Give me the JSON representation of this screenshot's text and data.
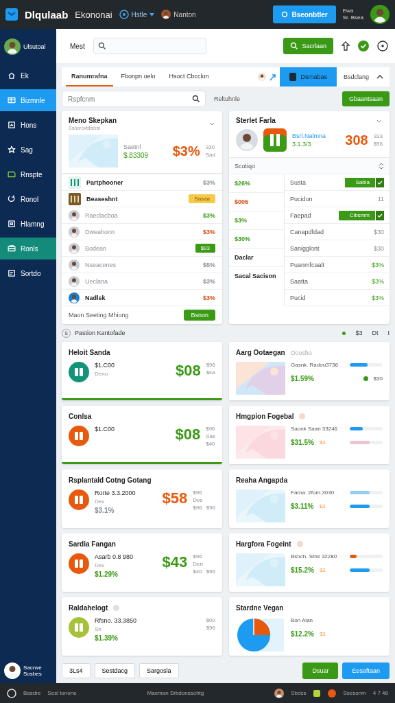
{
  "topbar": {
    "logo": "Dlqulaab",
    "app_name": "Ekononai",
    "nav": [
      {
        "label": "Hstle",
        "kind": "dropdown"
      },
      {
        "label": "Nanton",
        "kind": "user"
      }
    ],
    "action_button": "Bseonbtler",
    "status": [
      "Ewa",
      "Sr. Bsea"
    ]
  },
  "sidebar": {
    "user": "Ulsutoal",
    "items": [
      {
        "label": "Ek",
        "selected": false,
        "hovered": false
      },
      {
        "label": "Bizmnle",
        "selected": true,
        "hovered": false
      },
      {
        "label": "Hons",
        "selected": false,
        "hovered": false
      },
      {
        "label": "Sag",
        "selected": false,
        "hovered": false
      },
      {
        "label": "Rnspte",
        "selected": false,
        "hovered": false
      },
      {
        "label": "Ronol",
        "selected": false,
        "hovered": false
      },
      {
        "label": "Hlamng",
        "selected": false,
        "hovered": false
      },
      {
        "label": "Ronls",
        "selected": false,
        "hovered": true
      },
      {
        "label": "Sortdo",
        "selected": false,
        "hovered": false
      }
    ],
    "footer_user": [
      "Sacrwe",
      "Sosbes"
    ]
  },
  "header": {
    "title": "Mest",
    "button": "Sacrlaan"
  },
  "tabs": [
    {
      "label": "Ranumrafna",
      "selected": true
    },
    {
      "label": "Fbonpn oelo",
      "selected": false
    },
    {
      "label": "Hsoct Cbcclon",
      "selected": false
    }
  ],
  "tab_actions": {
    "primary": "Dsrnabas",
    "secondary": "Bsdclang"
  },
  "filter": {
    "placeholder": "Rspfcnm",
    "label": "Reltuhnle",
    "button": "Gbaantsaan"
  },
  "panels": {
    "left": {
      "title": "Meno Skepkan",
      "subtitle": "Ssnoroxtdstxte",
      "caption": "Saetnl",
      "amount": "$.83309",
      "big": "$3%",
      "side": [
        "330",
        "Sad"
      ],
      "rows": [
        {
          "label": "Partphooner",
          "bold": true,
          "kind": "value",
          "value": "$3%",
          "positive": false,
          "negative": false
        },
        {
          "label": "Beaseshnt",
          "bold": true,
          "kind": "badge",
          "value": "Sasaa",
          "warning": true
        },
        {
          "label": "Raeclacboa",
          "bold": false,
          "kind": "value",
          "value": "$3%",
          "positive": true,
          "negative": false
        },
        {
          "label": "Dweahonn",
          "bold": false,
          "kind": "value",
          "value": "$3%",
          "negative": true
        },
        {
          "label": "Bodean",
          "bold": false,
          "kind": "badge",
          "value": "$93",
          "warning": false
        },
        {
          "label": "Nseacenes",
          "bold": false,
          "kind": "value",
          "value": "$5%",
          "positive": false,
          "negative": false
        },
        {
          "label": "Ueclana",
          "bold": false,
          "kind": "value",
          "value": "$3%",
          "positive": false,
          "negative": false
        },
        {
          "label": "Nadlsk",
          "bold": true,
          "kind": "value",
          "value": "$3%",
          "negative": true
        }
      ],
      "footer": "Maon Seeting Mhiong",
      "footer_button": "Bsnon"
    },
    "right": {
      "title": "Sterlet Farla",
      "link": "Bsrl.Nalmna",
      "amount": "3.1.3/3",
      "big": "308",
      "side": [
        "333",
        "$96"
      ],
      "section": "Scotiqo",
      "left_items": [
        {
          "text": "$26%",
          "kind": "value",
          "negative": false
        },
        {
          "text": "$006",
          "kind": "value",
          "negative": true
        },
        {
          "text": "$3%",
          "kind": "value",
          "negative": false
        },
        {
          "text": "$30%",
          "kind": "value",
          "negative": false
        },
        {
          "text": "Daclar",
          "kind": "label"
        },
        {
          "text": "Sacal Sacison",
          "kind": "label"
        }
      ],
      "rows": [
        {
          "label": "Susta",
          "kind": "button",
          "value": "Sabla"
        },
        {
          "label": "Pucidon",
          "kind": "value",
          "value": "11",
          "positive": false
        },
        {
          "label": "Faepad",
          "kind": "button",
          "value": "Clbsmm"
        },
        {
          "label": "Canapdfdad",
          "kind": "value",
          "value": "$30",
          "positive": false
        },
        {
          "label": "Sanigglont",
          "kind": "value",
          "value": "$30",
          "positive": false
        },
        {
          "label": "Puanmfcaalt",
          "kind": "value",
          "value": "$3%",
          "positive": true
        },
        {
          "label": "Saatta",
          "kind": "value",
          "value": "$3%",
          "positive": true
        },
        {
          "label": "Pucid",
          "kind": "value",
          "value": "$3%",
          "positive": true
        }
      ]
    }
  },
  "section": {
    "badge": "S",
    "title": "Pastion Kantofade",
    "items": [
      "$3",
      "Dt",
      "I"
    ]
  },
  "grid": {
    "left": [
      {
        "title": "Heloit Sanda",
        "info": false,
        "color": "#129479",
        "amount": "$1.C00",
        "note": "Deno",
        "big": "$08",
        "positive": true,
        "side": [
          "$96",
          "$sa"
        ],
        "accent": true
      },
      {
        "title": "Conlsa",
        "info": false,
        "color": "#e8590c",
        "amount": "$1.C00",
        "big": "$08",
        "positive": true,
        "side": [
          "$96",
          "Sas",
          "$40"
        ],
        "accent": true
      },
      {
        "title": "Rsplantald Cotng Gotang",
        "info": false,
        "color": "#e8590c",
        "amount": "Rorte 3.3.2000",
        "note": "Dev",
        "change": "$3.1%",
        "change_positive": false,
        "big": "$58",
        "positive": false,
        "side": [
          "$96",
          "Dvs"
        ],
        "bottom": [
          "$96",
          "$96"
        ],
        "accent": false
      },
      {
        "title": "Sardia Fangan",
        "info": false,
        "color": "#e8590c",
        "amount": "Asarb 0.8 980",
        "note": "Dev",
        "change": "$1.29%",
        "change_positive": true,
        "big": "$43",
        "positive": true,
        "side": [
          "$96",
          "Den"
        ],
        "bottom": [
          "$40",
          "$96"
        ],
        "accent": false
      },
      {
        "title": "Raldahelogt",
        "info": true,
        "color": "#a7c23a",
        "amount": "Rfsno. 33.3850",
        "note": "Sh",
        "change": "$1.39%",
        "change_positive": true,
        "side": [
          "$00"
        ],
        "bottom": [
          "$96"
        ],
        "accent": false
      }
    ],
    "right": [
      {
        "title": "Aarg Ootaegan",
        "tag": "Ocosho",
        "info": false,
        "kind": "picture",
        "metric": "Gasnk. Radou3736",
        "change": "$1.59%",
        "status": "$30",
        "bars": [
          {
            "level": 0.55,
            "color": "#1d9bf0"
          }
        ]
      },
      {
        "title": "Hmgpion Fogebal",
        "info": true,
        "kind": "picture",
        "metric": "Saonk Saan 33246",
        "change": "$31.5%",
        "unit": "$3",
        "bars": [
          {
            "level": 0.4,
            "color": "#1d9bf0"
          },
          {
            "level": 0.6,
            "color": "#ecc3cf"
          }
        ]
      },
      {
        "title": "Reaha Angapda",
        "info": false,
        "kind": "picture",
        "metric": "Farna: 2fom.3030",
        "change": "$3.11%",
        "unit": "$3",
        "bars": [
          {
            "level": 0.6,
            "color": "#8fd0f2"
          },
          {
            "level": 0.6,
            "color": "#1d9bf0"
          }
        ]
      },
      {
        "title": "Hargfora Fogeint",
        "info": true,
        "kind": "picture",
        "metric": "Bsnch. Stns 32280",
        "change": "$15.2%",
        "unit": "$3",
        "bars": [
          {
            "level": 0.2,
            "color": "#e8590c"
          },
          {
            "level": 0.6,
            "color": "#1d9bf0"
          }
        ]
      },
      {
        "title": "Stardne Vegan",
        "info": false,
        "kind": "pie",
        "metric": "Bon Alan",
        "change": "$12.2%",
        "unit": "$3"
      }
    ]
  },
  "footer": {
    "tabs": [
      "3Ls4",
      "Sestdacg",
      "Sargosla"
    ],
    "buttons": [
      {
        "label": "Dsuar",
        "kind": "secondary"
      },
      {
        "label": "Eesaftaan",
        "kind": "primary"
      }
    ]
  },
  "bottombar": {
    "left": [
      "Basdre",
      "Sesl tonone"
    ],
    "status": "Maeman Srbdonssohtg",
    "user": "Sbdcs",
    "right": "Ssesonm",
    "time": "4 7 48"
  }
}
